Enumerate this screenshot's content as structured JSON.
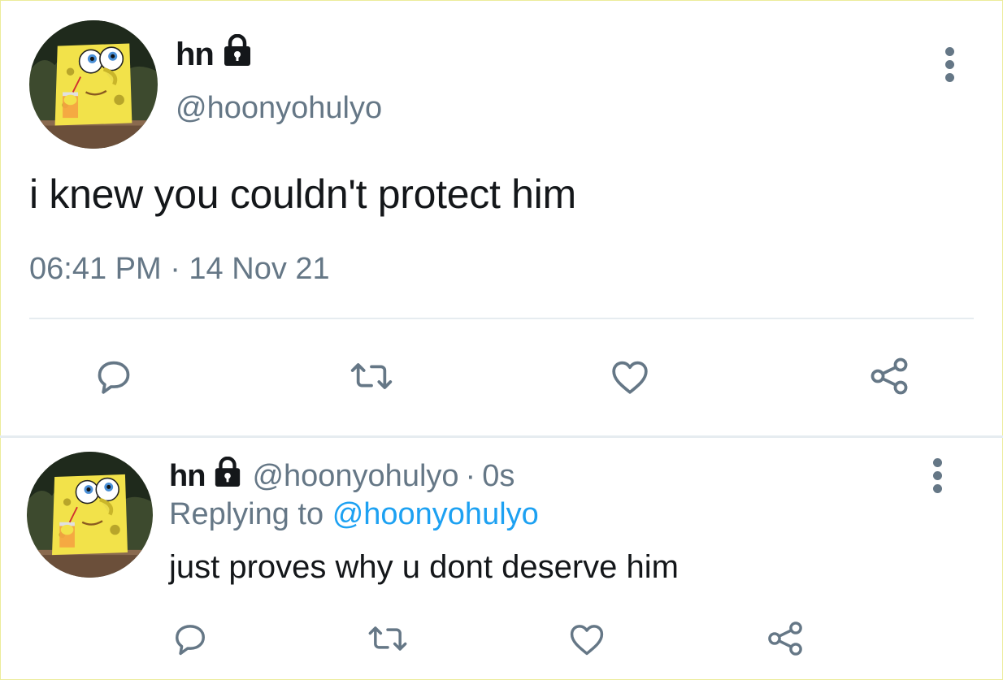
{
  "main_tweet": {
    "display_name": "hn",
    "handle": "@hoonyohulyo",
    "text": "i knew you couldn't protect him",
    "timestamp": "06:41 PM · 14 Nov 21",
    "avatar": "spongebob-avatar",
    "protected_icon": "lock-icon",
    "actions": [
      "reply-icon",
      "retweet-icon",
      "like-icon",
      "share-icon"
    ]
  },
  "reply_tweet": {
    "display_name": "hn",
    "handle": "@hoonyohulyo",
    "separator": "·",
    "age": "0s",
    "replying_prefix": "Replying to",
    "replying_to": "@hoonyohulyo",
    "text": "just proves why u dont deserve him",
    "avatar": "spongebob-avatar",
    "protected_icon": "lock-icon",
    "actions": [
      "reply-icon",
      "retweet-icon",
      "like-icon",
      "share-icon"
    ]
  },
  "colors": {
    "primary_text": "#14171a",
    "secondary_text": "#657786",
    "link": "#1da1f2",
    "divider": "#e6ecf0"
  }
}
